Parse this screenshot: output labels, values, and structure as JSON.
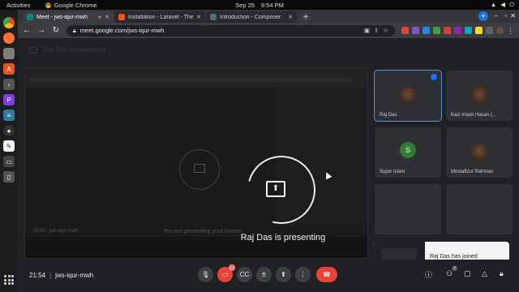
{
  "topbar": {
    "activities": "Activities",
    "app": "Google Chrome",
    "date": "Sep 25",
    "time": "9:54 PM"
  },
  "tabs": [
    {
      "title": "Meet - jws-iqur-mwh",
      "favicon_color": "#00897b",
      "active": true
    },
    {
      "title": "Installation - Laravel - The",
      "favicon_color": "#f4511e",
      "active": false
    },
    {
      "title": "Introduction - Composer",
      "favicon_color": "#546e7a",
      "active": false
    }
  ],
  "omnibox": {
    "url": "meet.google.com/jws-iqur-mwh"
  },
  "meet": {
    "header_name": "Raj Das is presenting",
    "presenting_text": "Raj Das is presenting",
    "ghost_text": "You are presenting your screen",
    "inner_clock": "16:54",
    "inner_code": "jws-iqur-mwh",
    "participants": [
      {
        "name": "Raj Das",
        "type": "photo",
        "active": true
      },
      {
        "name": "Kazi Imam Hasan (...",
        "type": "photo",
        "active": false
      },
      {
        "name": "Sujon Islam",
        "type": "initial",
        "initial": "S",
        "active": false
      },
      {
        "name": "Mostafizur Rahman",
        "type": "photo",
        "active": false
      },
      {
        "name": "",
        "type": "blank",
        "active": false
      },
      {
        "name": "",
        "type": "blank",
        "active": false
      }
    ],
    "toast": "Raj Das has joined",
    "bottom": {
      "clock": "21:54",
      "separator": "|",
      "code": "jws-iqur-mwh"
    },
    "mic_badge": "!",
    "people_count": "7"
  },
  "icons": {
    "mic": "mic-icon",
    "camera": "camera-off-icon",
    "captions": "captions-icon",
    "hand": "raise-hand-icon",
    "present": "present-icon",
    "more": "more-vert-icon",
    "hangup": "hangup-icon"
  }
}
